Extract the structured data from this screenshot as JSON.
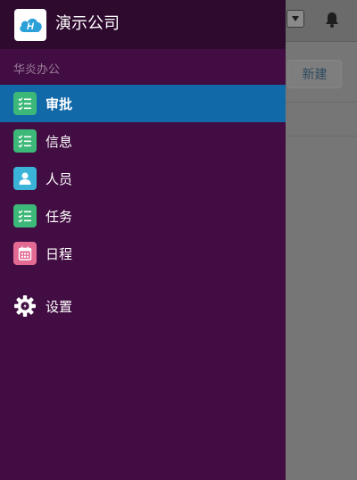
{
  "company": {
    "name": "演示公司",
    "logo_letter": "H"
  },
  "section_label": "华炎办公",
  "menu": [
    {
      "label": "审批",
      "icon": "checklist-icon",
      "active": true
    },
    {
      "label": "信息",
      "icon": "checklist-icon",
      "active": false
    },
    {
      "label": "人员",
      "icon": "person-icon",
      "active": false
    },
    {
      "label": "任务",
      "icon": "checklist-icon",
      "active": false
    },
    {
      "label": "日程",
      "icon": "calendar-icon",
      "active": false
    }
  ],
  "settings": {
    "label": "设置",
    "icon": "gear-icon"
  },
  "background": {
    "new_button": "新建"
  },
  "colors": {
    "drawer_bg": "#420d42",
    "header_bg": "#2e0a2e",
    "active_bg": "#1269a8",
    "green_icon": "#3cb878",
    "cyan_icon": "#3bb3d8",
    "pink_icon": "#e36a92"
  }
}
